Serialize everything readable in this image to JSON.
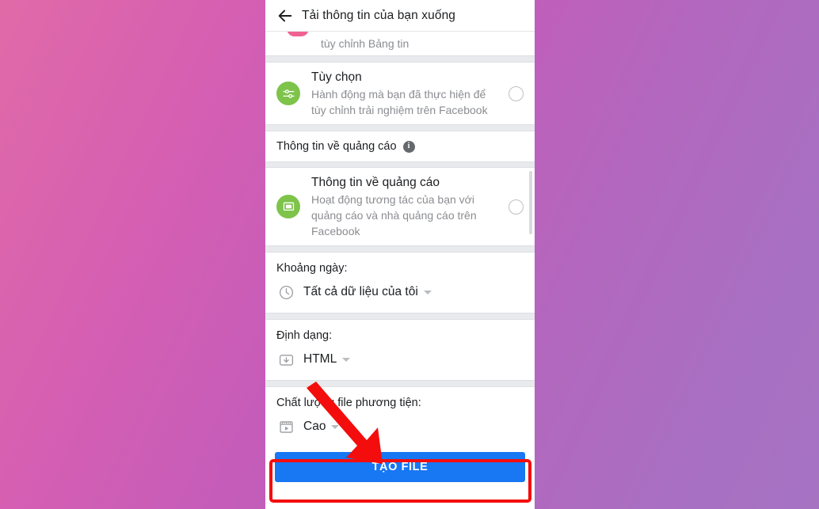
{
  "background": {
    "gradient_from": "#e06aa8",
    "gradient_to": "#a673c3"
  },
  "appbar": {
    "back_icon": "arrow-left-icon",
    "title": "Tải thông tin của bạn xuống"
  },
  "cut_off_row": {
    "description": "tùy chỉnh Bảng tin",
    "icon": "pink-circle-icon"
  },
  "items": [
    {
      "id": "tuy-chon",
      "title": "Tùy chọn",
      "description": "Hành động mà bạn đã thực hiện để tùy chỉnh trải nghiệm trên Facebook",
      "icon": "sliders-icon",
      "icon_color": "#7ec34a",
      "selected": false
    },
    {
      "id": "thong-tin-quang-cao",
      "title": "Thông tin về quảng cáo",
      "description": "Hoạt động tương tác của bạn với quảng cáo và nhà quảng cáo trên Facebook",
      "icon": "monitor-icon",
      "icon_color": "#7ec34a",
      "selected": false
    }
  ],
  "section_header": {
    "label": "Thông tin về quảng cáo",
    "info_icon": "info-icon",
    "info_glyph": "i"
  },
  "fields": [
    {
      "id": "khoang-ngay",
      "label": "Khoảng ngày:",
      "value": "Tất cả dữ liệu của tôi",
      "icon": "clock-icon"
    },
    {
      "id": "dinh-dang",
      "label": "Định dạng:",
      "value": "HTML",
      "icon": "download-folder-icon"
    },
    {
      "id": "chat-luong-file",
      "label": "Chất lượng file phương tiện:",
      "value": "Cao",
      "icon": "media-player-icon"
    }
  ],
  "cta": {
    "label": "TẠO FILE",
    "color": "#1877f2",
    "highlight_color": "#f40d0d"
  },
  "annotation": {
    "arrow_color": "#f40d0d",
    "arrow_icon": "arrow-down-right-icon"
  }
}
